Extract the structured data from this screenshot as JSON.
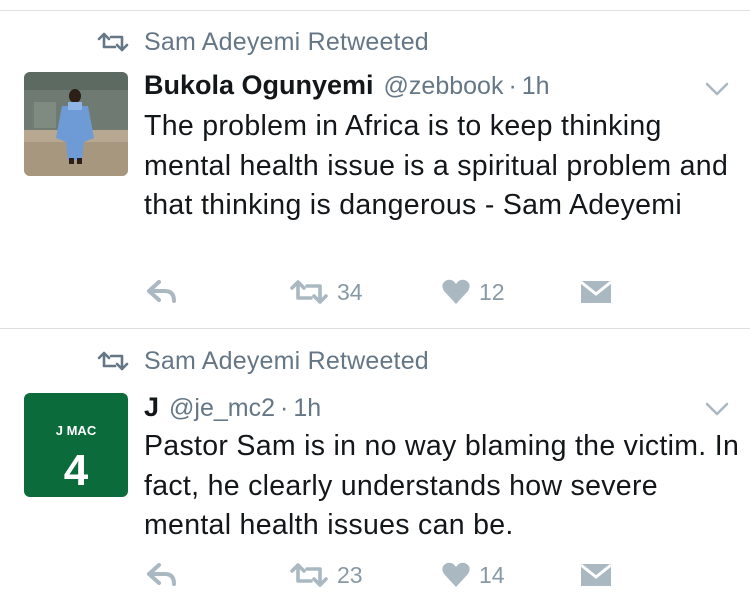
{
  "colors": {
    "icon_gray": "#aab8c2",
    "meta_gray": "#657786",
    "text": "#14171a",
    "divider": "#dcdfe2",
    "jmac_green": "#0b6b3a"
  },
  "tweets": [
    {
      "retweet_text": "Sam Adeyemi Retweeted",
      "name": "Bukola Ogunyemi",
      "handle": "@zebbook",
      "separator": "·",
      "time": "1h",
      "text": "The problem in Africa is to keep thinking mental health issue is a spiritual problem and that thinking is dangerous - Sam Adeyemi",
      "retweets": "34",
      "likes": "12",
      "icons": [
        "reply-icon",
        "retweet-icon",
        "heart-icon",
        "message-icon",
        "chevron-down-icon"
      ]
    },
    {
      "retweet_text": "Sam Adeyemi Retweeted",
      "name": "J",
      "handle": "@je_mc2",
      "separator": "·",
      "time": "1h",
      "text": "Pastor Sam is in no way blaming the victim. In fact, he clearly understands how severe mental health issues can be.",
      "retweets": "23",
      "likes": "14",
      "avatar_label": "J MAC",
      "avatar_number": "4",
      "icons": [
        "reply-icon",
        "retweet-icon",
        "heart-icon",
        "message-icon",
        "chevron-down-icon"
      ]
    }
  ]
}
